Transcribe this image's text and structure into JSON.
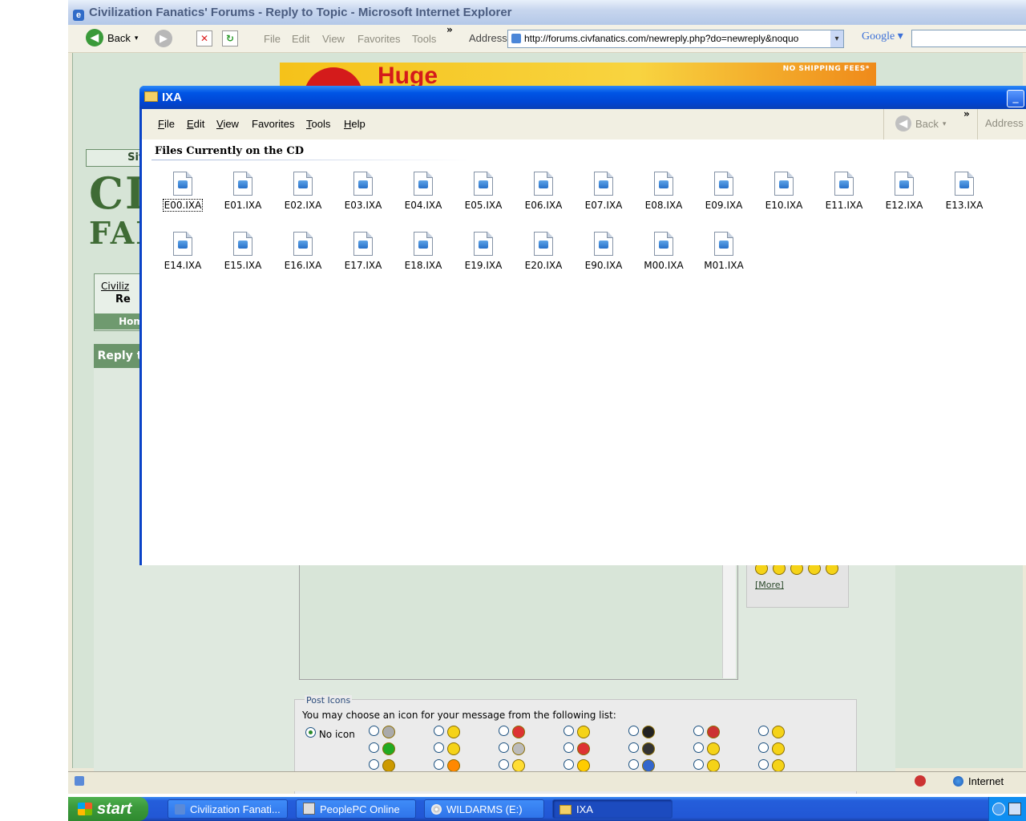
{
  "ie": {
    "title": "Civilization Fanatics' Forums - Reply to Topic - Microsoft Internet Explorer",
    "back_label": "Back",
    "menu": [
      "File",
      "Edit",
      "View",
      "Favorites",
      "Tools"
    ],
    "chevron": "»",
    "address_label": "Address",
    "address_url": "http://forums.civfanatics.com/newreply.php?do=newreply&noquo",
    "google_label": "Google",
    "status_zone": "Internet"
  },
  "page": {
    "ad_big": "Huge",
    "ad_small": "NO SHIPPING FEES*",
    "site_label": "Site",
    "logo_line1": "CIV",
    "logo_line2": "FAN",
    "crumb_link": "Civiliz",
    "crumb_current": "Re",
    "crumb_home": "Home",
    "reply_heading": "Reply to",
    "smilies_more": "[More]",
    "post_icons_title": "Post Icons",
    "post_icons_desc": "You may choose an icon for your message from the following list:",
    "no_icon_label": "No icon"
  },
  "explorer": {
    "title": "IXA",
    "menu": [
      {
        "key": "F",
        "rest": "ile"
      },
      {
        "key": "E",
        "rest": "dit"
      },
      {
        "key": "V",
        "rest": "iew"
      },
      {
        "key": "F",
        "rest": "avorites",
        "pre": "",
        "full": "Favorites"
      },
      {
        "key": "T",
        "rest": "ools"
      },
      {
        "key": "H",
        "rest": "elp"
      }
    ],
    "back_label": "Back",
    "chevron": "»",
    "address_label": "Address",
    "section_label": "Files Currently on the CD",
    "files": [
      "E00.IXA",
      "E01.IXA",
      "E02.IXA",
      "E03.IXA",
      "E04.IXA",
      "E05.IXA",
      "E06.IXA",
      "E07.IXA",
      "E08.IXA",
      "E09.IXA",
      "E10.IXA",
      "E11.IXA",
      "E12.IXA",
      "E13.IXA",
      "E14.IXA",
      "E15.IXA",
      "E16.IXA",
      "E17.IXA",
      "E18.IXA",
      "E19.IXA",
      "E20.IXA",
      "E90.IXA",
      "M00.IXA",
      "M01.IXA"
    ],
    "selected_file": "E00.IXA"
  },
  "taskbar": {
    "start_label": "start",
    "tasks": [
      "Civilization Fanati...",
      "PeoplePC Online",
      "WILDARMS (E:)",
      "IXA"
    ],
    "active_task": "IXA"
  }
}
